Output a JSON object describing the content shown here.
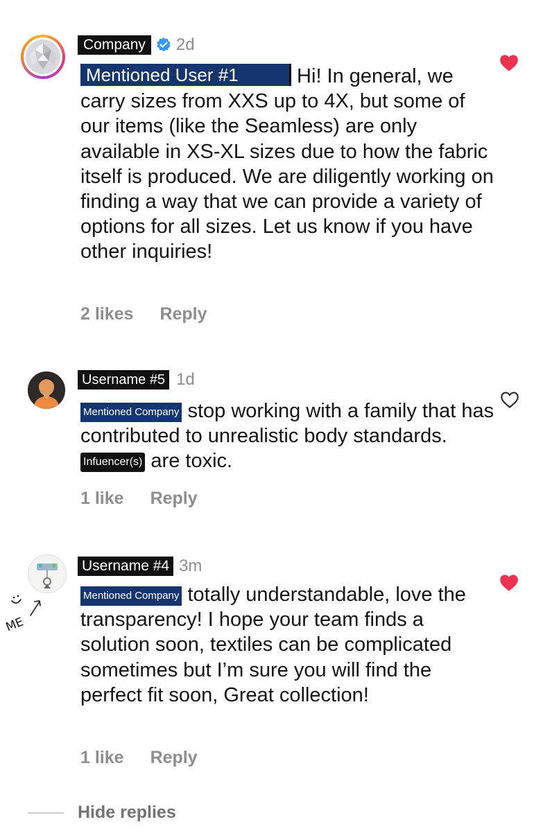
{
  "comments": [
    {
      "username": "Company",
      "verified": true,
      "time": "2d",
      "mention": "Mentioned User #1",
      "text": " Hi! In general, we carry sizes from XXS up to 4X, but some of our items (like the Seamless) are only available in XS-XL sizes due to how the fabric itself is produced. We are diligently working on finding a way that we can provide a variety of options for all sizes. Let us know if you have other inquiries!",
      "likes": "2 likes",
      "reply": "Reply",
      "liked": true
    },
    {
      "username": "Username #5",
      "time": "1d",
      "mention": "Mentioned Company",
      "text_before": " stop working with a family that has contributed to unrealistic body standards. ",
      "tag": "Infuencer(s)",
      "text_after": " are toxic.",
      "likes": "1 like",
      "reply": "Reply",
      "liked": false
    },
    {
      "username": "Username #4",
      "time": "3m",
      "mention": "Mentioned Company",
      "text": " totally understandable, love the transparency! I hope your team finds a solution soon, textiles can be complicated sometimes but I’m sure you will find the perfect fit soon, Great collection!",
      "likes": "1 like",
      "reply": "Reply",
      "liked": true
    }
  ],
  "hide_replies": "Hide replies",
  "annotation": "ME",
  "colors": {
    "heart_liked": "#ed3150",
    "mention_bg": "#14356e",
    "verified": "#3897f0"
  }
}
